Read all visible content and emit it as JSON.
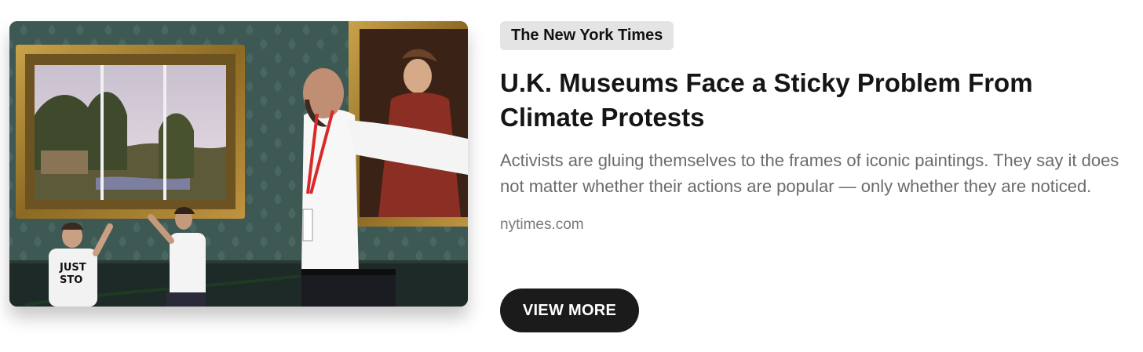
{
  "article": {
    "source": "The New York Times",
    "headline": "U.K. Museums Face a Sticky Problem From Climate Protests",
    "description": "Activists are gluing themselves to the frames of iconic paintings. They say it does not matter whether their actions are popular — only whether they are noticed.",
    "domain": "nytimes.com",
    "cta_label": "VIEW MORE",
    "image": {
      "shirt_text_line1": "JUST",
      "shirt_text_line2": "STO"
    }
  },
  "colors": {
    "badge_bg": "#e4e4e4",
    "headline": "#151515",
    "description": "#6b6b6b",
    "domain": "#7a7a7a",
    "button_bg": "#1b1b1b",
    "button_text": "#ffffff"
  }
}
